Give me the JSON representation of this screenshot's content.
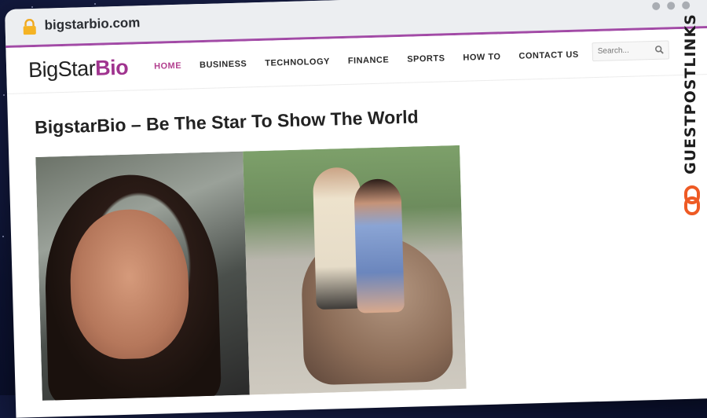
{
  "browser": {
    "url": "bigstarbio.com",
    "icons": {
      "lock": "lock-icon",
      "window_dots": "window-dots-icon"
    }
  },
  "site": {
    "logo": {
      "part1": "BigStar",
      "part2": "Bio"
    },
    "colors": {
      "accent": "#a0348f",
      "nav_active": "#b3408f",
      "chrome_border": "#a24aa6"
    },
    "nav": [
      {
        "label": "HOME",
        "active": true
      },
      {
        "label": "BUSINESS"
      },
      {
        "label": "TECHNOLOGY"
      },
      {
        "label": "FINANCE"
      },
      {
        "label": "SPORTS"
      },
      {
        "label": "HOW TO"
      },
      {
        "label": "CONTACT US"
      }
    ],
    "search": {
      "placeholder": "Search...",
      "icon": "search-icon"
    }
  },
  "article": {
    "title": "BigstarBio – Be The Star To Show The World"
  },
  "watermark": {
    "text": "GUESTPOSTLINKS",
    "icon": "link-icon",
    "color": "#ee5a24"
  }
}
